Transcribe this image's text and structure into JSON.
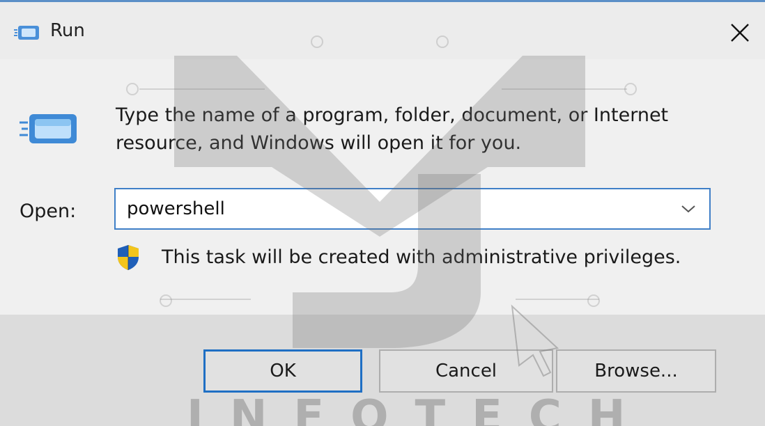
{
  "window": {
    "title": "Run",
    "close_icon": "close-icon"
  },
  "body": {
    "description": "Type the name of a program, folder, document, or Internet resource, and Windows will open it for you.",
    "open_label": "Open:",
    "open_value": "powershell",
    "admin_notice": "This task will be created with administrative privileges."
  },
  "buttons": {
    "ok": "OK",
    "cancel": "Cancel",
    "browse": "Browse..."
  },
  "watermark": {
    "text": "INFOTECH"
  },
  "colors": {
    "accent": "#1f6fc4",
    "input_border": "#3f7fc7",
    "window_bg": "#f0f0f0",
    "footer_bg": "#dcdcdc"
  }
}
